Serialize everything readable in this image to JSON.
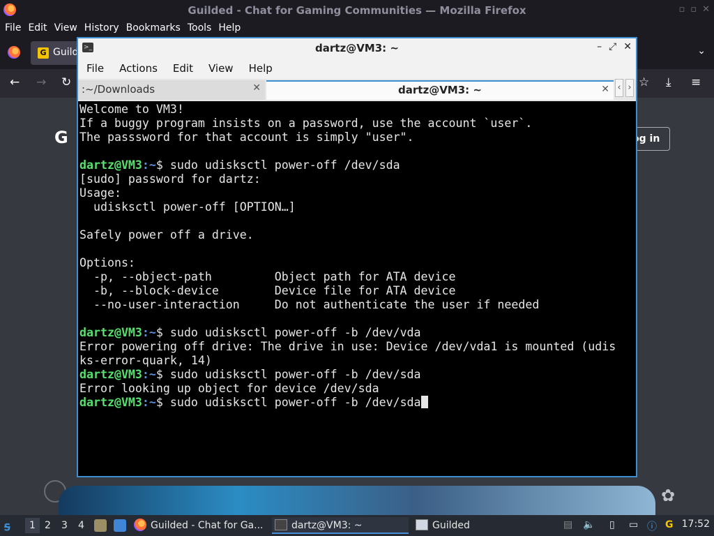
{
  "firefox": {
    "window_title": "Guilded - Chat for Gaming Communities — Mozilla Firefox",
    "menu": [
      "File",
      "Edit",
      "View",
      "History",
      "Bookmarks",
      "Tools",
      "Help"
    ],
    "tab_label": "Guild",
    "page": {
      "login_label": "og in"
    }
  },
  "terminal": {
    "title": "dartz@VM3: ~",
    "menu": [
      "File",
      "Actions",
      "Edit",
      "View",
      "Help"
    ],
    "tabs": [
      {
        "label": ":~/Downloads",
        "active": false
      },
      {
        "label": "dartz@VM3: ~",
        "active": true
      }
    ],
    "lines": [
      {
        "text": "Welcome to VM3!"
      },
      {
        "text": "If a buggy program insists on a password, use the account `user`."
      },
      {
        "text": "The passsword for that account is simply \"user\"."
      },
      {
        "text": ""
      },
      {
        "prompt_user": "dartz@VM3",
        "prompt_path": ":~",
        "text": "$ sudo udisksctl power-off /dev/sda"
      },
      {
        "text": "[sudo] password for dartz:"
      },
      {
        "text": "Usage:"
      },
      {
        "text": "  udisksctl power-off [OPTION…]"
      },
      {
        "text": ""
      },
      {
        "text": "Safely power off a drive."
      },
      {
        "text": ""
      },
      {
        "text": "Options:"
      },
      {
        "text": "  -p, --object-path         Object path for ATA device"
      },
      {
        "text": "  -b, --block-device        Device file for ATA device"
      },
      {
        "text": "  --no-user-interaction     Do not authenticate the user if needed"
      },
      {
        "text": ""
      },
      {
        "prompt_user": "dartz@VM3",
        "prompt_path": ":~",
        "text": "$ sudo udisksctl power-off -b /dev/vda"
      },
      {
        "text": "Error powering off drive: The drive in use: Device /dev/vda1 is mounted (udis"
      },
      {
        "text": "ks-error-quark, 14)"
      },
      {
        "prompt_user": "dartz@VM3",
        "prompt_path": ":~",
        "text": "$ sudo udisksctl power-off -b /dev/sda"
      },
      {
        "text": "Error looking up object for device /dev/sda"
      },
      {
        "prompt_user": "dartz@VM3",
        "prompt_path": ":~",
        "text": "$ sudo udisksctl power-off -b /dev/sda",
        "cursor": true
      }
    ]
  },
  "taskbar": {
    "workspaces": [
      "1",
      "2",
      "3",
      "4"
    ],
    "active_workspace": "1",
    "tasks": [
      {
        "label": "Guilded - Chat for Ga...",
        "icon": "firefox-icon"
      },
      {
        "label": "dartz@VM3: ~",
        "icon": "terminal-icon",
        "active": true
      },
      {
        "label": "Guilded",
        "icon": "window-icon"
      }
    ],
    "clock": "17:52"
  }
}
